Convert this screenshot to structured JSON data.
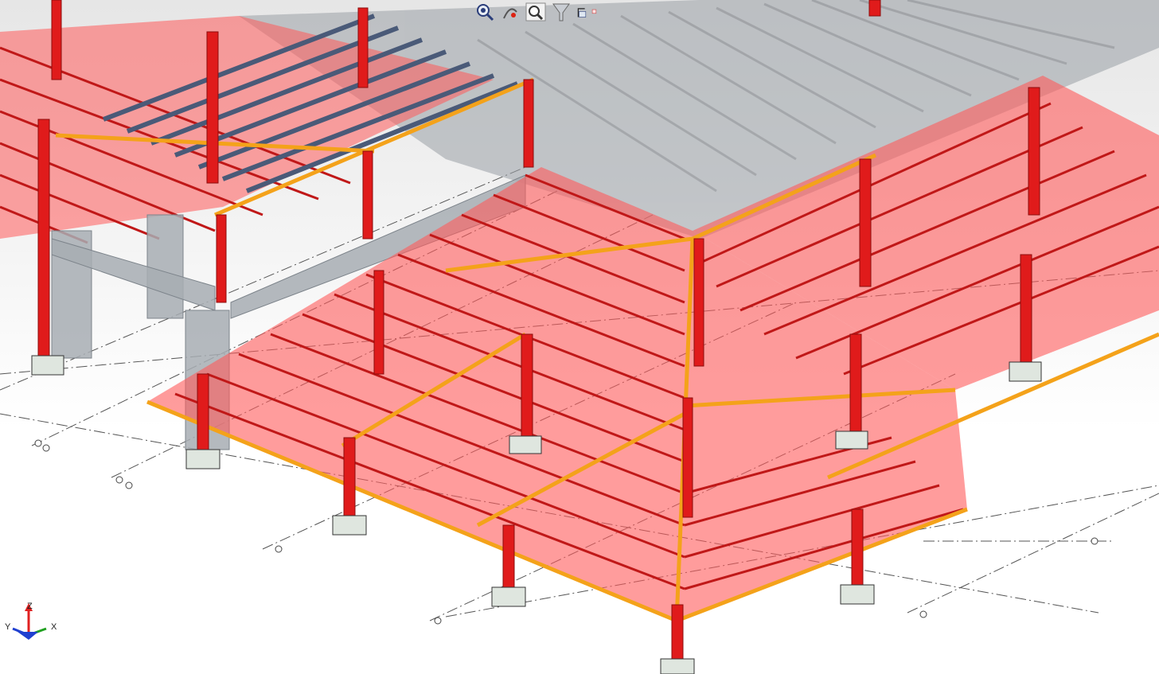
{
  "toolbar": {
    "items": [
      {
        "name": "zoom-extents-icon"
      },
      {
        "name": "pan-icon"
      },
      {
        "name": "zoom-icon"
      },
      {
        "name": "filter-icon"
      },
      {
        "name": "view-cube-icon"
      }
    ]
  },
  "axes": {
    "x": "X",
    "y": "Y",
    "z": "Z"
  },
  "colors": {
    "background": "#ffffff",
    "roof_panel": "#ff5a5a",
    "steel_member": "#e01b1b",
    "purlin_orange": "#f4a21a",
    "beam_blue": "#4a5a78",
    "concrete": "#a7adb3",
    "grid_line": "#555555"
  }
}
